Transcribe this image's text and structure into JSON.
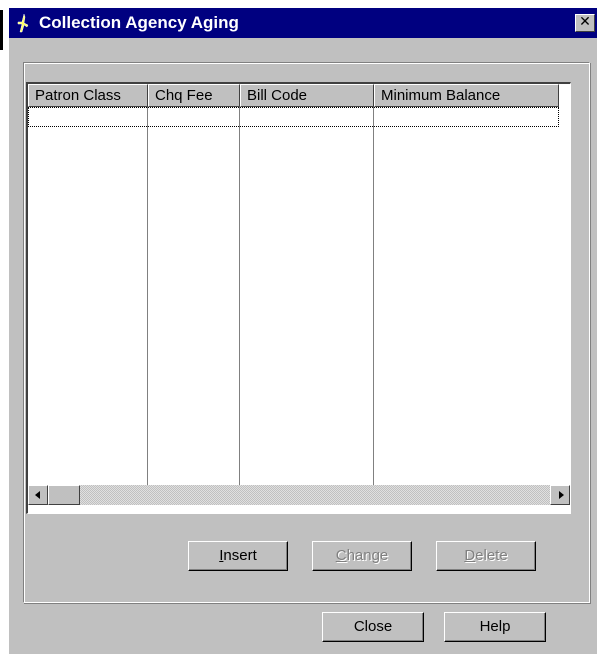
{
  "window": {
    "title": "Collection Agency Aging",
    "close_glyph": "✕"
  },
  "grid": {
    "columns": [
      "Patron Class",
      "Chq Fee",
      "Bill Code",
      "Minimum Balance"
    ],
    "rows": []
  },
  "buttons": {
    "insert": {
      "label": "Insert",
      "mnemonic": "I",
      "rest": "nsert",
      "enabled": true
    },
    "change": {
      "label": "Change",
      "mnemonic": "C",
      "rest": "hange",
      "enabled": false
    },
    "delete": {
      "label": "Delete",
      "mnemonic": "D",
      "rest": "elete",
      "enabled": false
    },
    "close": {
      "label": "Close"
    },
    "help": {
      "label": "Help"
    }
  },
  "colors": {
    "titlebar": "#000080",
    "face": "#c0c0c0"
  },
  "icons": {
    "title": "app-figure-icon",
    "scroll_left": "arrow-left-icon",
    "scroll_right": "arrow-right-icon"
  }
}
